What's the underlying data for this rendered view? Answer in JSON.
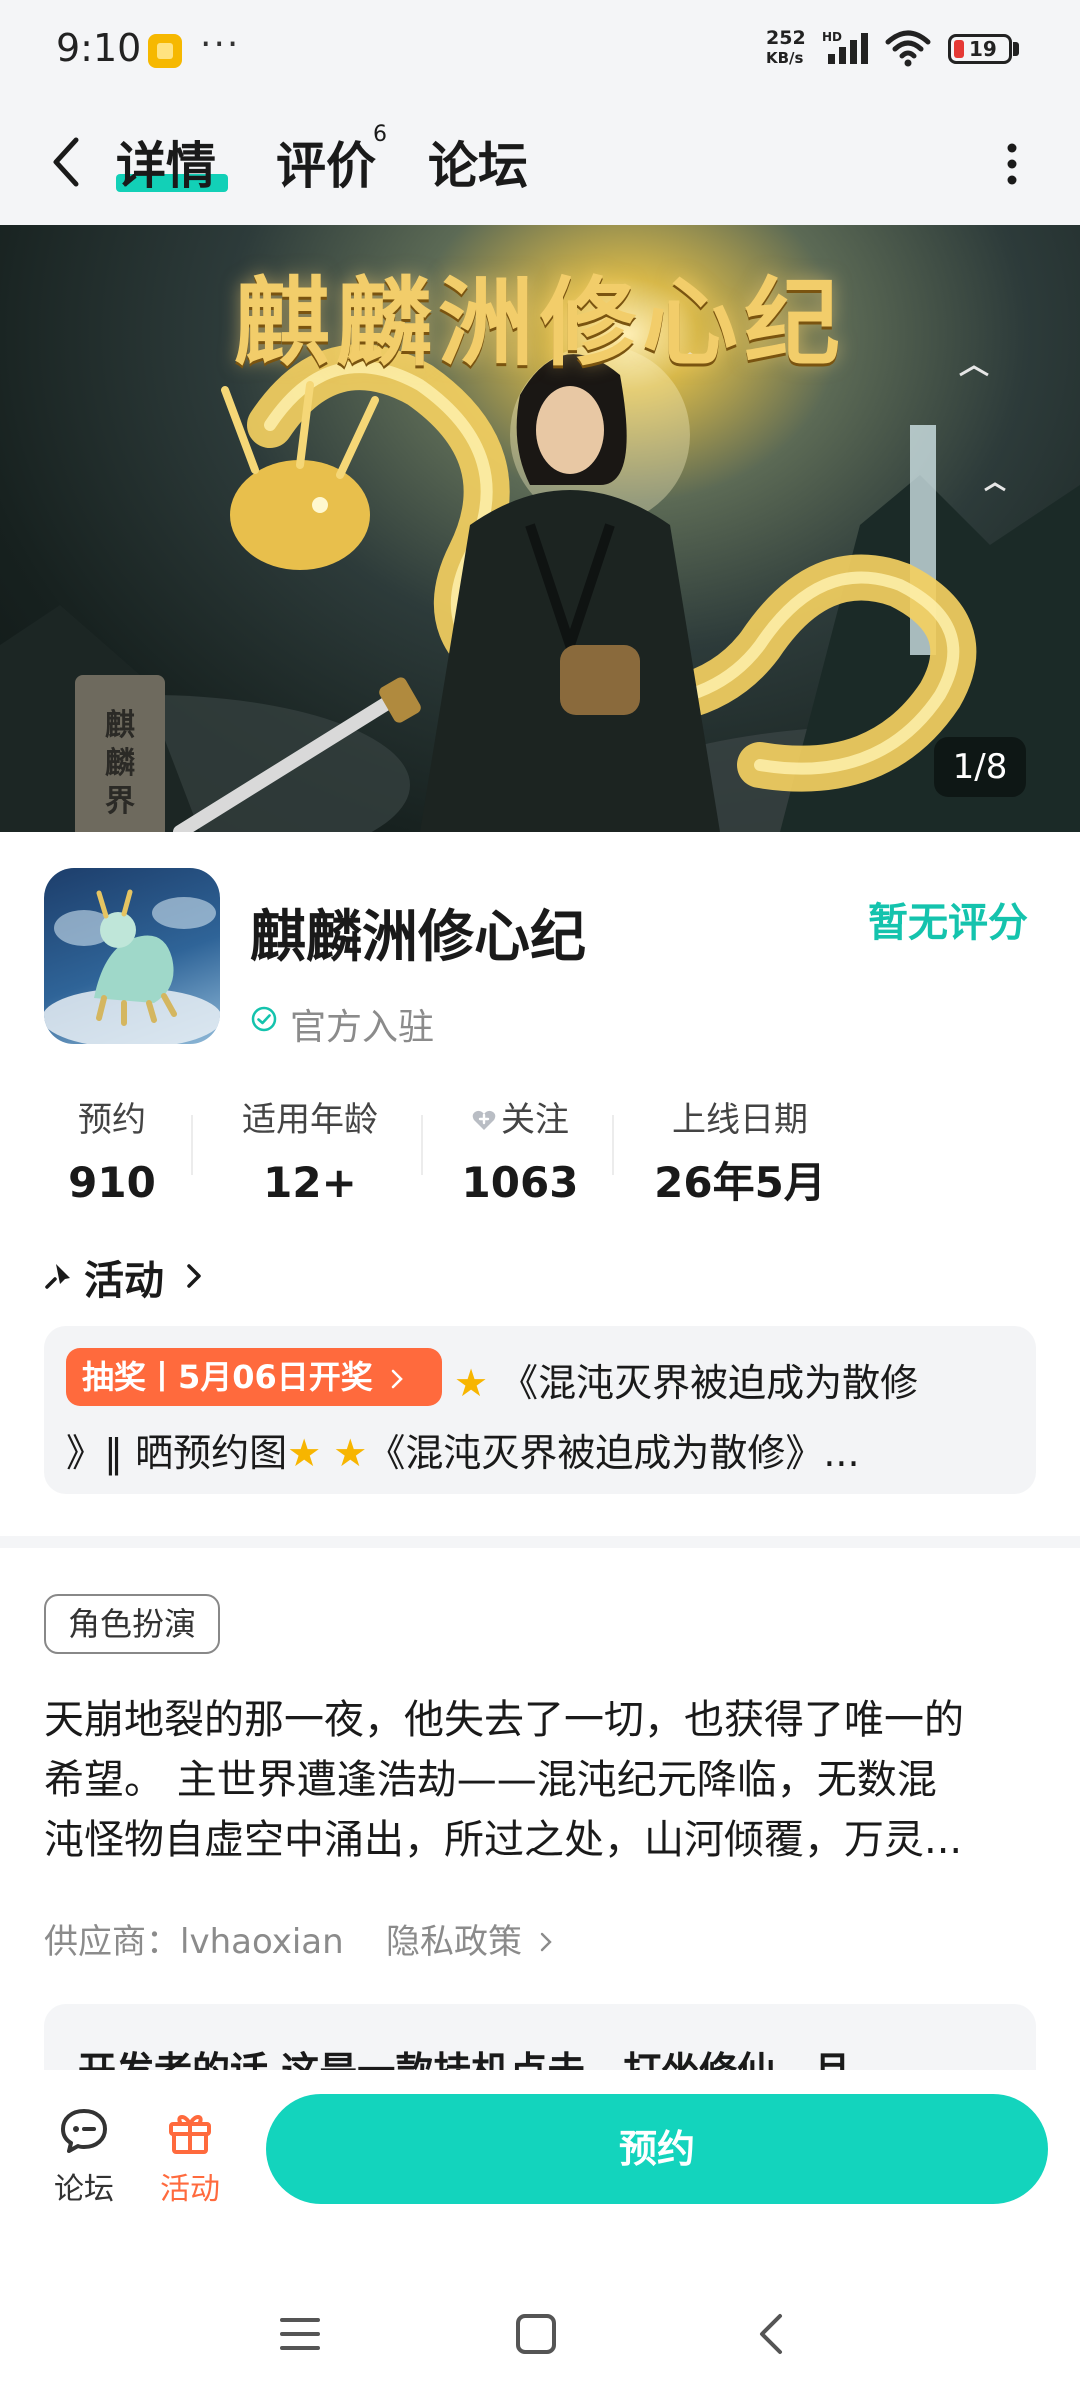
{
  "status_bar": {
    "time": "9:10",
    "more": "···",
    "net_speed_value": "252",
    "net_speed_unit": "KB/s",
    "network": "HD",
    "battery": "19"
  },
  "nav": {
    "tabs": [
      {
        "label": "详情",
        "active": true
      },
      {
        "label": "评价",
        "count": "6"
      },
      {
        "label": "论坛"
      }
    ]
  },
  "banner": {
    "title": "麒麟洲修心纪",
    "stone_text": "麒麟界",
    "pager": "1/8"
  },
  "app": {
    "name": "麒麟洲修心纪",
    "rating": "暂无评分",
    "verified": "官方入驻"
  },
  "stats": [
    {
      "label": "预约",
      "value": "910"
    },
    {
      "label": "适用年龄",
      "value": "12+"
    },
    {
      "label": "关注",
      "value": "1063"
    },
    {
      "label": "上线日期",
      "value": "26年5月"
    }
  ],
  "activity": {
    "title": "活动",
    "badge": "抽奖丨5月06日开奖",
    "line1": "《混沌灭界被迫成为散修",
    "line2_part1": "》‖ 晒预约图",
    "line2_part2": "《混沌灭界被迫成为散修》..."
  },
  "description": {
    "tag": "角色扮演",
    "lines": [
      "天崩地裂的那一夜，他失去了一切，也获得了唯一的",
      "希望。 主世界遭逢浩劫——混沌纪元降临，无数混",
      "沌怪物自虚空中涌出，所过之处，山河倾覆，万灵..."
    ],
    "supplier": "供应商：lvhaoxian",
    "privacy": "隐私政策"
  },
  "developer": {
    "text": "开发者的话  这是一款挂机点击、打坐修仙、且"
  },
  "bottom_bar": {
    "forum": "论坛",
    "activity": "活动",
    "reserve": "预约"
  },
  "colors": {
    "accent": "#13d4bd",
    "badge": "#ff6a3d",
    "activity_label": "#ff6a3d"
  }
}
